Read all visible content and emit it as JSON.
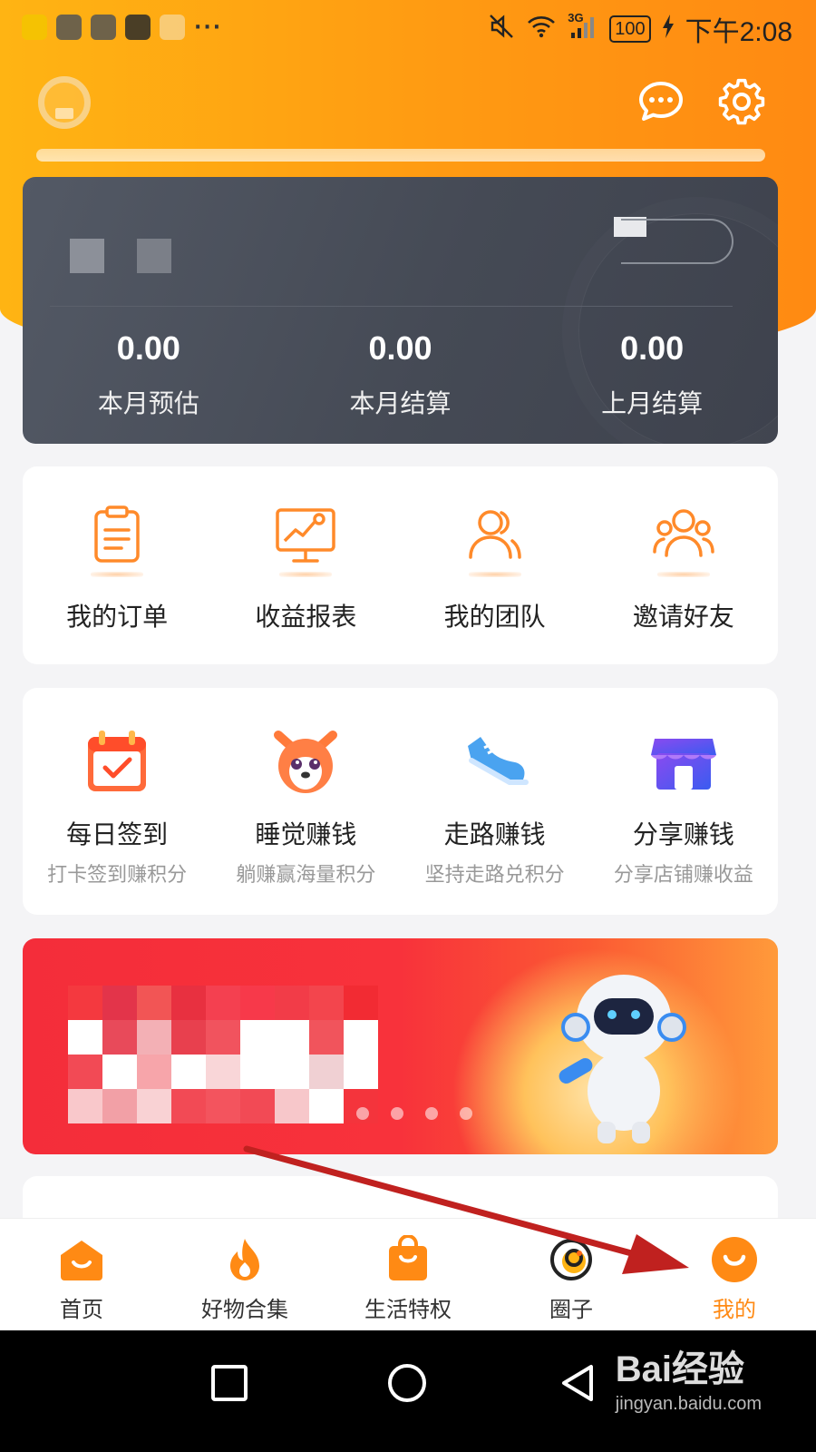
{
  "status_bar": {
    "time": "下午2:08",
    "battery": "100",
    "network": "3G",
    "more_indicator": "···"
  },
  "header": {
    "message_icon": "chat-bubble-icon",
    "settings_icon": "gear-icon"
  },
  "earnings": {
    "stats": [
      {
        "value": "0.00",
        "label": "本月预估"
      },
      {
        "value": "0.00",
        "label": "本月结算"
      },
      {
        "value": "0.00",
        "label": "上月结算"
      }
    ]
  },
  "tools": [
    {
      "label": "我的订单",
      "icon": "clipboard-icon"
    },
    {
      "label": "收益报表",
      "icon": "chart-board-icon"
    },
    {
      "label": "我的团队",
      "icon": "team-icon"
    },
    {
      "label": "邀请好友",
      "icon": "invite-group-icon"
    }
  ],
  "tasks": [
    {
      "label": "每日签到",
      "sub": "打卡签到赚积分",
      "icon": "calendar-check-icon"
    },
    {
      "label": "睡觉赚钱",
      "sub": "躺赚赢海量积分",
      "icon": "dog-icon"
    },
    {
      "label": "走路赚钱",
      "sub": "坚持走路兑积分",
      "icon": "sneaker-icon"
    },
    {
      "label": "分享赚钱",
      "sub": "分享店铺赚收益",
      "icon": "store-icon"
    }
  ],
  "banner": {
    "active_index": 0,
    "count": 5
  },
  "tabbar": [
    {
      "label": "首页",
      "icon": "home-icon",
      "active": false
    },
    {
      "label": "好物合集",
      "icon": "flame-icon",
      "active": false
    },
    {
      "label": "生活特权",
      "icon": "shopping-bag-icon",
      "active": false
    },
    {
      "label": "圈子",
      "icon": "circle-icon",
      "active": false
    },
    {
      "label": "我的",
      "icon": "smile-icon",
      "active": true
    }
  ],
  "watermark": {
    "brand": "Bai经验",
    "url": "jingyan.baidu.com"
  },
  "colors": {
    "accent": "#ff8a14",
    "header_start": "#ffb413",
    "card_dark": "#454a55",
    "annotation_arrow": "#c0211f"
  }
}
